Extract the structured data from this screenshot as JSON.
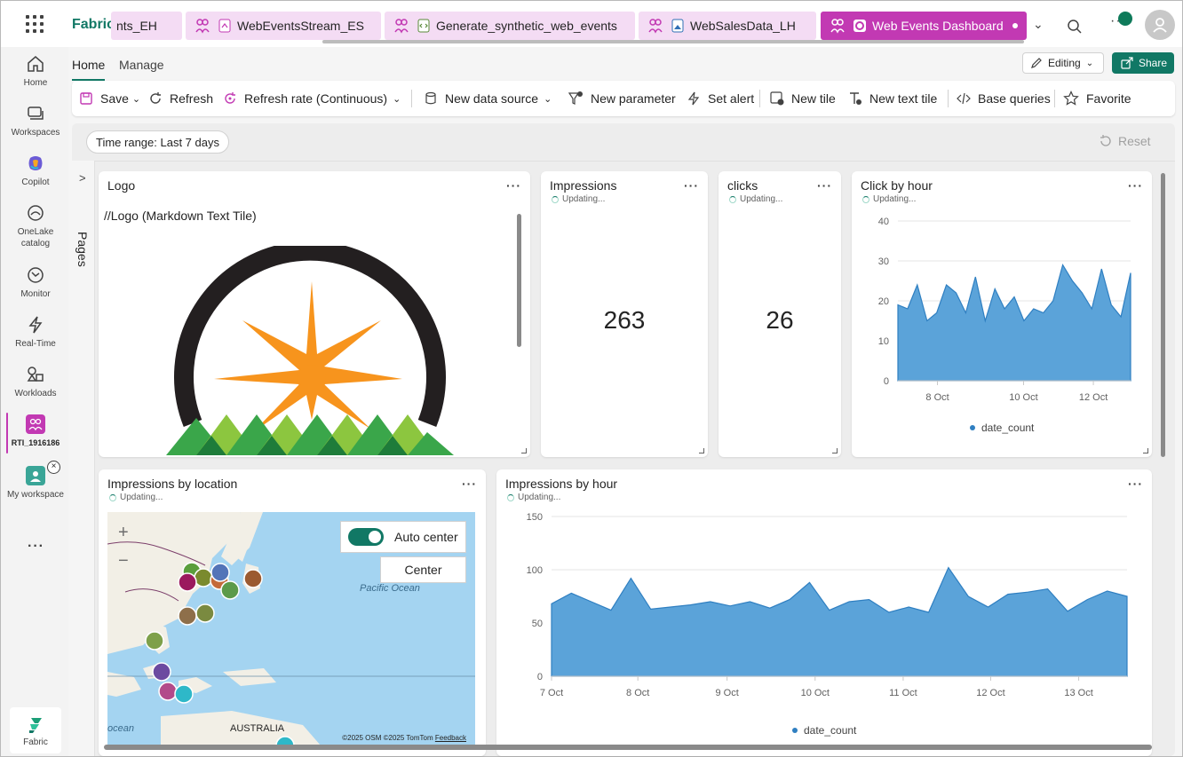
{
  "topbar": {
    "brand": "Fabric",
    "tabs": [
      {
        "label": "nts_EH",
        "icon": "eventhouse-icon"
      },
      {
        "label": "WebEventsStream_ES",
        "icon": "eventstream-icon"
      },
      {
        "label": "Generate_synthetic_web_events",
        "icon": "notebook-icon"
      },
      {
        "label": "WebSalesData_LH",
        "icon": "lakehouse-icon"
      },
      {
        "label": "Web Events Dashboard",
        "icon": "dashboard-icon",
        "active": true
      }
    ]
  },
  "rail": {
    "items": [
      {
        "label": "Home",
        "icon": "home-icon"
      },
      {
        "label": "Workspaces",
        "icon": "workspaces-icon"
      },
      {
        "label": "Copilot",
        "icon": "copilot-icon"
      },
      {
        "label": "OneLake catalog",
        "icon": "onelake-icon"
      },
      {
        "label": "Monitor",
        "icon": "monitor-icon"
      },
      {
        "label": "Real-Time",
        "icon": "realtime-icon"
      },
      {
        "label": "Workloads",
        "icon": "workloads-icon"
      },
      {
        "label": "RTI_1916186",
        "icon": "workspace-rti-icon"
      },
      {
        "label": "My workspace",
        "icon": "my-workspace-icon"
      }
    ],
    "bottom_label": "Fabric"
  },
  "header": {
    "tabs": [
      "Home",
      "Manage"
    ],
    "editing_label": "Editing",
    "share_label": "Share"
  },
  "toolbar": {
    "save": "Save",
    "refresh": "Refresh",
    "refresh_rate": "Refresh rate (Continuous)",
    "new_data_source": "New data source",
    "new_parameter": "New parameter",
    "set_alert": "Set alert",
    "new_tile": "New tile",
    "new_text_tile": "New text tile",
    "base_queries": "Base queries",
    "favorite": "Favorite"
  },
  "filters": {
    "time_range": "Time range: Last 7 days",
    "reset": "Reset"
  },
  "pages_label": "Pages",
  "status_text": "Updating...",
  "tiles": {
    "logo": {
      "title": "Logo",
      "markdown": "//Logo (Markdown Text Tile)"
    },
    "impressions": {
      "title": "Impressions",
      "value": "263"
    },
    "clicks": {
      "title": "clicks",
      "value": "26"
    },
    "click_by_hour": {
      "title": "Click by hour"
    },
    "impressions_by_location": {
      "title": "Impressions by location"
    },
    "impressions_by_hour": {
      "title": "Impressions by hour"
    }
  },
  "map": {
    "auto_center_label": "Auto center",
    "center_label": "Center",
    "zoom_in": "+",
    "zoom_out": "−",
    "ocean_label": "Pacific Ocean",
    "land_label": "AUSTRALIA",
    "sea_label": "ocean",
    "credits": "©2025 OSM  ©2025 TomTom",
    "feedback": "Feedback"
  },
  "colors": {
    "accent": "#117865",
    "active_tab": "#c239b3",
    "area_fill": "#5ba3d9",
    "area_stroke": "#2f7fc1"
  },
  "chart_data": [
    {
      "type": "area",
      "title": "Click by hour",
      "x": [
        "7 Oct",
        "8 Oct",
        "9 Oct",
        "10 Oct",
        "11 Oct",
        "12 Oct",
        "13 Oct"
      ],
      "series": [
        {
          "name": "date_count",
          "values": [
            19,
            18,
            24,
            15,
            17,
            24,
            22,
            17,
            26,
            15,
            23,
            18,
            21,
            15,
            18,
            17,
            20,
            29,
            25,
            22,
            18,
            28,
            19,
            16,
            27
          ]
        }
      ],
      "ylim": [
        0,
        40
      ],
      "yticks": [
        0,
        10,
        20,
        30,
        40
      ],
      "xticks": [
        "8 Oct",
        "10 Oct",
        "12 Oct"
      ],
      "legend": "bottom"
    },
    {
      "type": "area",
      "title": "Impressions by hour",
      "x": [
        "7 Oct",
        "8 Oct",
        "9 Oct",
        "10 Oct",
        "11 Oct",
        "12 Oct",
        "13 Oct"
      ],
      "series": [
        {
          "name": "date_count",
          "values": [
            68,
            78,
            70,
            62,
            92,
            63,
            65,
            67,
            70,
            66,
            70,
            64,
            72,
            88,
            62,
            70,
            72,
            60,
            65,
            60,
            102,
            75,
            65,
            77,
            79,
            82,
            61,
            72,
            80,
            75
          ]
        }
      ],
      "ylim": [
        0,
        150
      ],
      "yticks": [
        0,
        50,
        100,
        150
      ],
      "xticks": [
        "7 Oct",
        "8 Oct",
        "9 Oct",
        "10 Oct",
        "11 Oct",
        "12 Oct",
        "13 Oct"
      ],
      "legend": "bottom"
    }
  ]
}
